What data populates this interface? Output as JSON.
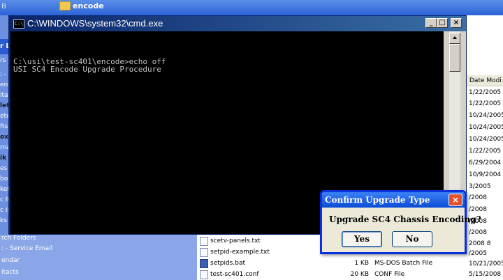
{
  "explorer": {
    "title_fragment": "B",
    "folder_title": "encode",
    "date_header": "Date Modi",
    "dates": [
      "1/22/2005",
      "1/22/2005",
      "10/24/2005",
      "10/24/2005",
      "10/24/2005",
      "1/22/2005",
      "6/29/2004",
      "10/9/2004",
      "3/2005",
      "/2008",
      "/2008",
      "/2008",
      "/2008",
      "2008 8",
      "/2005",
      "10/21/2005",
      "5/15/2008"
    ],
    "left_labels": [
      "r L",
      "rs",
      ": - R",
      "end.",
      "itac",
      "lete",
      "etec",
      "fts",
      "ox",
      "rnal",
      "ik E",
      "es",
      "box",
      "ketf",
      "c It",
      "c Is",
      "ks"
    ],
    "nav_items": [
      "rch Folders",
      ": - Service Email",
      "endar",
      "itacts"
    ],
    "files": [
      {
        "name": "scetv-panels.txt",
        "size": "",
        "type": ""
      },
      {
        "name": "setpid-example.txt",
        "size": "",
        "type": ""
      },
      {
        "name": "setpids.bat",
        "size": "1 KB",
        "type": "MS-DOS Batch File"
      },
      {
        "name": "test-sc401.conf",
        "size": "20 KB",
        "type": "CONF File"
      }
    ]
  },
  "cmd": {
    "title": "C:\\WINDOWS\\system32\\cmd.exe",
    "lines": [
      "C:\\usi\\test-sc401\\encode>echo off",
      "USI SC4 Encode Upgrade Procedure"
    ],
    "minimize": "_",
    "maximize": "□",
    "close": "×"
  },
  "dialog": {
    "title": "Confirm Upgrade Type",
    "question": "Upgrade SC4 Chassis Encoding?",
    "yes_label": "Yes",
    "no_label": "No",
    "close": "×"
  }
}
